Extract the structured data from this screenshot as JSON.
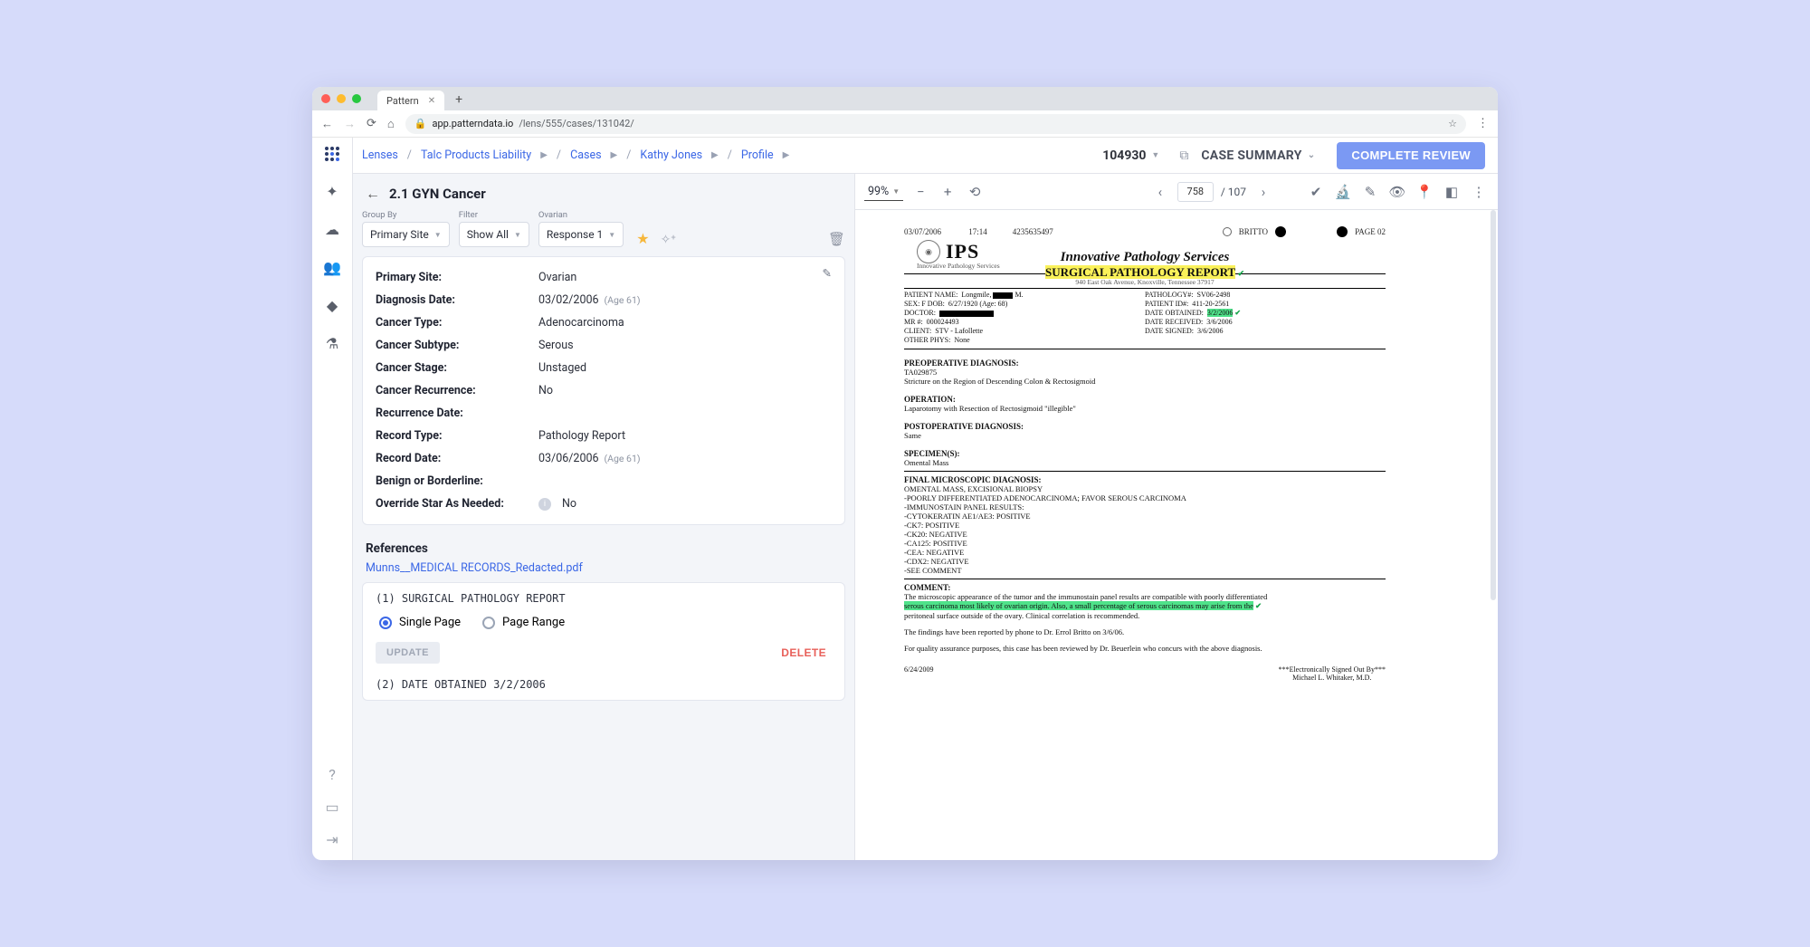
{
  "browser": {
    "tab_title": "Pattern",
    "url_host": "app.patterndata.io",
    "url_path": "/lens/555/cases/131042/"
  },
  "breadcrumbs": {
    "items": [
      "Lenses",
      "Talc Products Liability",
      "Cases",
      "Kathy Jones",
      "Profile"
    ]
  },
  "header": {
    "record_id": "104930",
    "case_summary_label": "CASE SUMMARY",
    "complete_label": "COMPLETE REVIEW"
  },
  "section": {
    "title": "2.1 GYN Cancer"
  },
  "filters": {
    "group_by_label": "Group By",
    "group_by_value": "Primary Site",
    "filter_label": "Filter",
    "filter_value": "Show All",
    "third_label": "Ovarian",
    "third_value": "Response 1"
  },
  "card": {
    "rows": [
      {
        "k": "Primary Site:",
        "v": "Ovarian"
      },
      {
        "k": "Diagnosis Date:",
        "v": "03/02/2006",
        "age": "(Age 61)"
      },
      {
        "k": "Cancer Type:",
        "v": "Adenocarcinoma"
      },
      {
        "k": "Cancer Subtype:",
        "v": "Serous"
      },
      {
        "k": "Cancer Stage:",
        "v": "Unstaged"
      },
      {
        "k": "Cancer Recurrence:",
        "v": "No"
      },
      {
        "k": "Recurrence Date:",
        "v": ""
      },
      {
        "k": "Record Type:",
        "v": "Pathology Report"
      },
      {
        "k": "Record Date:",
        "v": "03/06/2006",
        "age": "(Age 61)"
      },
      {
        "k": "Benign or Borderline:",
        "v": ""
      },
      {
        "k": "Override Star As Needed:",
        "v": "No",
        "info": true
      }
    ]
  },
  "references": {
    "title": "References",
    "file": "Munns__MEDICAL RECORDS_Redacted.pdf",
    "item1_idx": "(1)",
    "item1_text": "SURGICAL PATHOLOGY REPORT",
    "single_page": "Single Page",
    "page_range": "Page Range",
    "update": "UPDATE",
    "delete": "DELETE",
    "item2_idx": "(2)",
    "item2_text": "DATE OBTAINED 3/2/2006"
  },
  "doc_toolbar": {
    "zoom": "99%",
    "page": "758",
    "total": "107"
  },
  "document": {
    "hdr_date": "03/07/2006",
    "hdr_time": "17:14",
    "hdr_num": "4235635497",
    "hdr_name": "BRITTO",
    "hdr_page": "PAGE  02",
    "company": "Innovative Pathology Services",
    "report_title": "SURGICAL PATHOLOGY REPORT",
    "ips_sub": "Innovative Pathology Services",
    "addr": "940 East Oak Avenue, Knoxville, Tennessee 37917",
    "pt": {
      "l1a": "PATIENT NAME:",
      "l1b": "Longmile,",
      "l1c": "PATHOLOGY#:",
      "l1d": "SV06-2498",
      "l2a": "SEX:  F   DOB:",
      "l2b": "6/27/1920  (Age: 68)",
      "l2c": "PATIENT ID#:",
      "l2d": "411-20-2561",
      "l3a": "DOCTOR:",
      "l3c": "DATE OBTAINED:",
      "l3d": "3/2/2006",
      "l4a": "MR #:",
      "l4b": "000024493",
      "l4c": "DATE RECEIVED:",
      "l4d": "3/6/2006",
      "l5a": "CLIENT:",
      "l5b": "STV - Lafollette",
      "l5c": "DATE SIGNED:",
      "l5d": "3/6/2006",
      "l6a": "OTHER PHYS:",
      "l6b": "None"
    },
    "preop_h": "PREOPERATIVE DIAGNOSIS:",
    "preop_1": "TA029875",
    "preop_2": "Stricture on the Region of Descending Colon & Rectosigmoid",
    "op_h": "OPERATION:",
    "op_1": "Laparotomy with Resection of Rectosigmoid \"illegible\"",
    "postop_h": "POSTOPERATIVE DIAGNOSIS:",
    "postop_1": "Same",
    "spec_h": "SPECIMEN(S):",
    "spec_1": "Omental Mass",
    "fmd_h": "FINAL MICROSCOPIC DIAGNOSIS:",
    "fmd_lines": [
      "OMENTAL MASS, EXCISIONAL BIOPSY",
      "-POORLY DIFFERENTIATED ADENOCARCINOMA; FAVOR SEROUS CARCINOMA",
      "-IMMUNOSTAIN PANEL RESULTS:",
      "  -CYTOKERATIN AE1/AE3:  POSITIVE",
      "  -CK7:  POSITIVE",
      "  -CK20:  NEGATIVE",
      "  -CA125:  POSITIVE",
      "  -CEA:  NEGATIVE",
      "  -CDX2:  NEGATIVE",
      "-SEE COMMENT"
    ],
    "comment_h": "COMMENT:",
    "comment_1": "The microscopic appearance of the tumor and the immunostain panel results are compatible with poorly differentiated",
    "comment_hl": "serous carcinoma most likely of ovarian origin.  Also, a small percentage of serous carcinomas may arise from the",
    "comment_2": "peritoneal surface outside of the ovary. Clinical correlation is recommended.",
    "comment_3": "The findings have been reported by phone to Dr. Errol Britto on 3/6/06.",
    "comment_4": "For quality assurance purposes, this case has been reviewed by Dr. Beuerlein who concurs with the above diagnosis.",
    "sign": "***Electronically Signed Out By***",
    "sign2": "Michael L. Whitaker, M.D.",
    "footer_date": "6/24/2009"
  }
}
